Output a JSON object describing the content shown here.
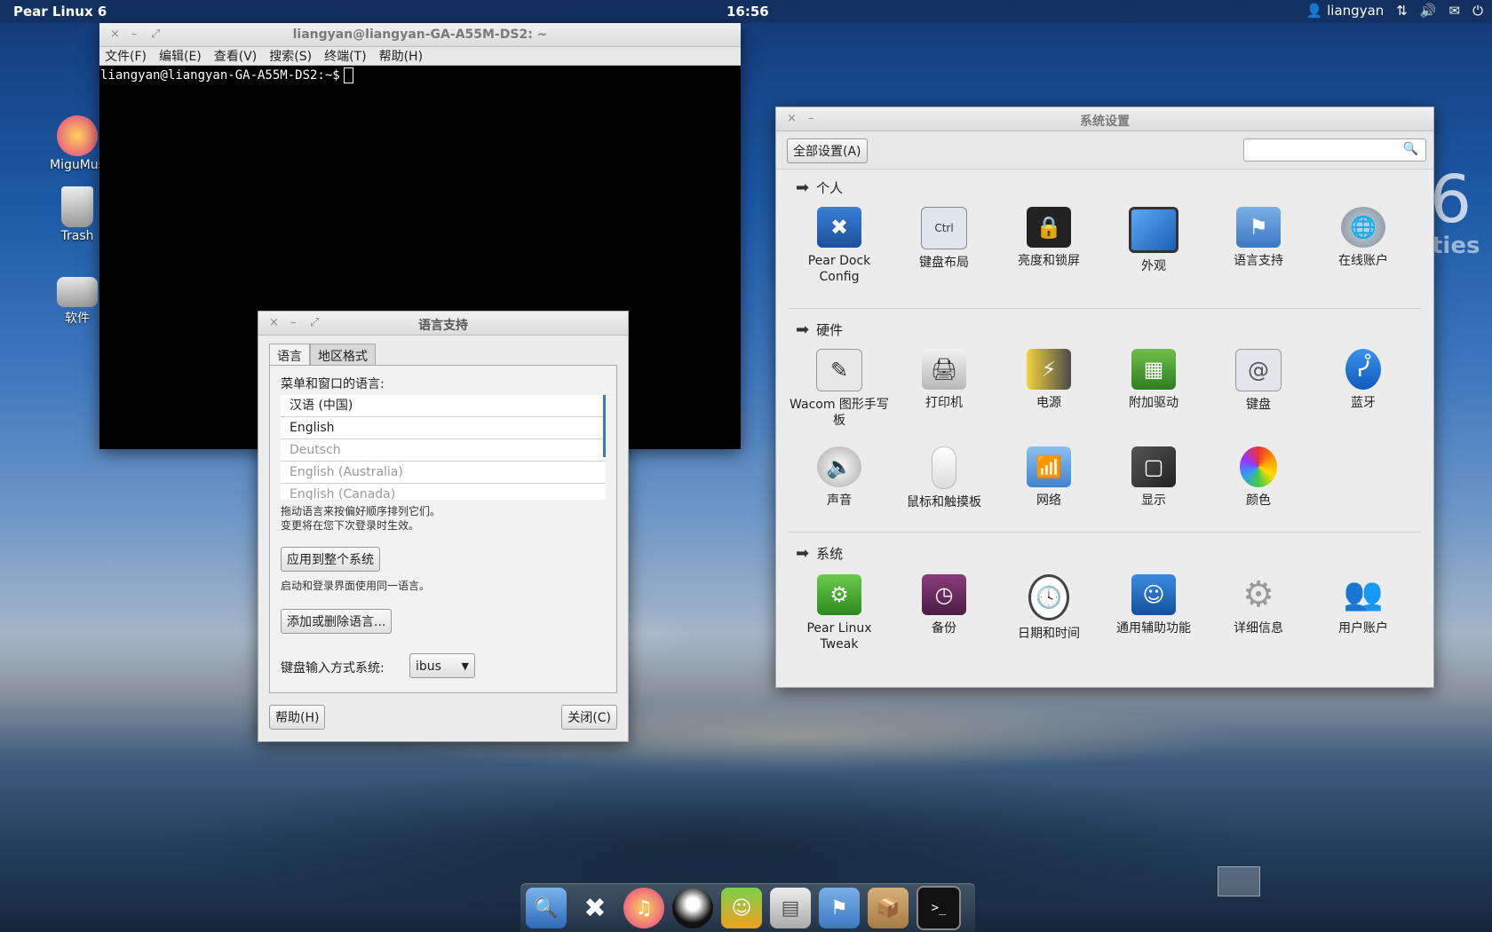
{
  "topbar": {
    "brand": "Pear Linux 6",
    "clock": "16:56",
    "user": "liangyan",
    "icons": [
      "user-icon",
      "network-icon",
      "volume-icon",
      "mail-icon",
      "power-icon"
    ]
  },
  "wallpaper": {
    "number": "6",
    "text": "ties"
  },
  "desktop": {
    "icons": [
      {
        "label": "MiguMus",
        "icon": "music-icon"
      },
      {
        "label": "Trash",
        "icon": "trash-icon"
      },
      {
        "label": "软件",
        "icon": "drive-icon"
      }
    ]
  },
  "terminal": {
    "title": "liangyan@liangyan-GA-A55M-DS2: ~",
    "menu": [
      "文件(F)",
      "编辑(E)",
      "查看(V)",
      "搜索(S)",
      "终端(T)",
      "帮助(H)"
    ],
    "prompt": "liangyan@liangyan-GA-A55M-DS2:~$"
  },
  "language_dialog": {
    "title": "语言支持",
    "tabs": [
      "语言",
      "地区格式"
    ],
    "menu_label": "菜单和窗口的语言:",
    "languages": [
      "汉语 (中国)",
      "English",
      "Deutsch",
      "English (Australia)",
      "English (Canada)"
    ],
    "drag_note_1": "拖动语言来按偏好顺序排列它们。",
    "drag_note_2": "变更将在您下次登录时生效。",
    "apply_button": "应用到整个系统",
    "login_note": "启动和登录界面使用同一语言。",
    "add_remove_button": "添加或删除语言...",
    "input_label": "键盘输入方式系统:",
    "input_value": "ibus",
    "help_button": "帮助(H)",
    "close_button": "关闭(C)"
  },
  "settings": {
    "title": "系统设置",
    "all_settings": "全部设置(A)",
    "search_placeholder": "",
    "sections": [
      {
        "name": "个人",
        "items": [
          "Pear Dock Config",
          "键盘布局",
          "亮度和锁屏",
          "外观",
          "语言支持",
          "在线账户"
        ]
      },
      {
        "name": "硬件",
        "items": [
          "Wacom 图形手写板",
          "打印机",
          "电源",
          "附加驱动",
          "键盘",
          "蓝牙",
          "声音",
          "鼠标和触摸板",
          "网络",
          "显示",
          "颜色"
        ]
      },
      {
        "name": "系统",
        "items": [
          "Pear Linux Tweak",
          "备份",
          "日期和时间",
          "通用辅助功能",
          "详细信息",
          "用户账户"
        ]
      }
    ]
  },
  "dock": {
    "icons": [
      "search-icon",
      "tools-icon",
      "music-icon",
      "qq-penguin-icon",
      "pps-icon",
      "file-cabinet-icon",
      "language-flag-icon",
      "package-icon",
      "terminal-icon"
    ]
  }
}
